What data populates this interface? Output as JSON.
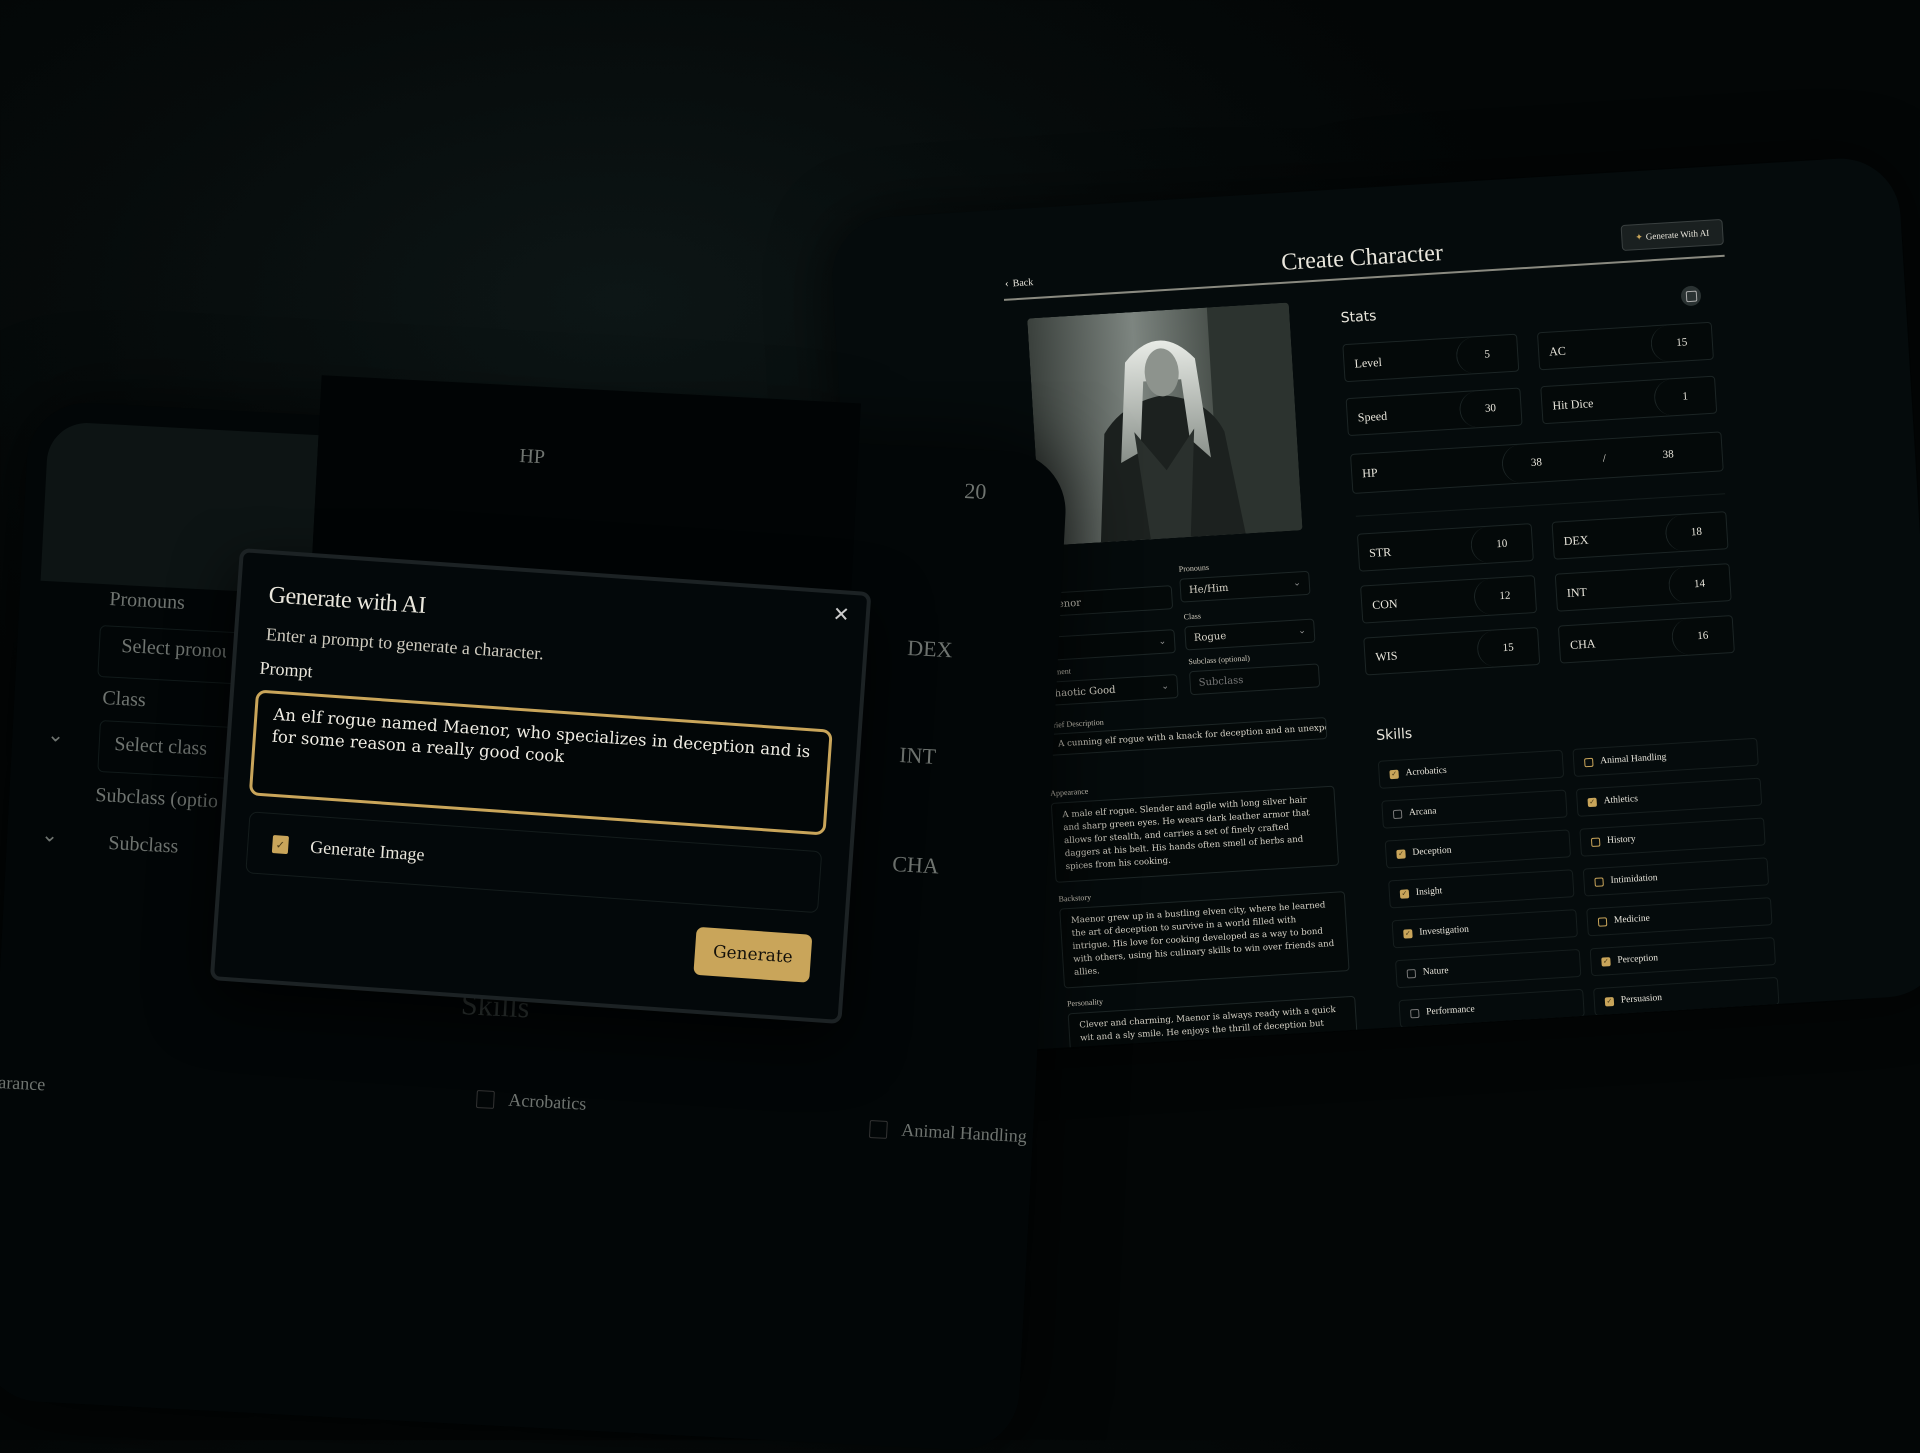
{
  "colors": {
    "accent": "#c9a55a",
    "background": "#030606",
    "panel": "#050b0c"
  },
  "character_form": {
    "back_label": "Back",
    "title": "Create Character",
    "generate_ai_label": "Generate With AI",
    "icons": {
      "back": "chevron-left-icon",
      "sparkle": "sparkle-icon",
      "dice": "dice-icon"
    },
    "name_value": "Maenor",
    "pronouns": {
      "label": "Pronouns",
      "value": "He/Him"
    },
    "class": {
      "label": "Class",
      "value": "Rogue"
    },
    "subclass": {
      "label": "Subclass (optional)",
      "placeholder": "Subclass"
    },
    "alignment": {
      "label": "Alignment",
      "value": "Chaotic Good"
    },
    "brief_description": {
      "label": "Brief Description",
      "value": "A cunning elf rogue with a knack for deception and an unexpe"
    },
    "appearance": {
      "label": "Appearance",
      "value": "A male elf rogue. Slender and agile with long silver hair and sharp green eyes. He wears dark leather armor that allows for stealth, and carries a set of finely crafted daggers at his belt. His hands often smell of herbs and spices from his cooking."
    },
    "backstory": {
      "label": "Backstory",
      "value": "Maenor grew up in a bustling elven city, where he learned the art of deception to survive in a world filled with intrigue. His love for cooking developed as a way to bond with others, using his culinary skills to win over friends and allies."
    },
    "personality": {
      "label": "Personality",
      "value": "Clever and charming, Maenor is always ready with a quick wit and a sly smile. He enjoys the thrill of deception but values loyalty and friendship above all."
    },
    "stats": {
      "title": "Stats",
      "level": {
        "label": "Level",
        "value": "5"
      },
      "ac": {
        "label": "AC",
        "value": "15"
      },
      "speed": {
        "label": "Speed",
        "value": "30"
      },
      "hit_dice": {
        "label": "Hit Dice",
        "value": "1"
      },
      "hp": {
        "label": "HP",
        "current": "38",
        "separator": "/",
        "max": "38"
      },
      "str": {
        "label": "STR",
        "value": "10"
      },
      "dex": {
        "label": "DEX",
        "value": "18"
      },
      "con": {
        "label": "CON",
        "value": "12"
      },
      "int": {
        "label": "INT",
        "value": "14"
      },
      "wis": {
        "label": "WIS",
        "value": "15"
      },
      "cha": {
        "label": "CHA",
        "value": "16"
      }
    },
    "skills": {
      "title": "Skills",
      "items": [
        {
          "label": "Acrobatics",
          "checked": true
        },
        {
          "label": "Animal Handling",
          "checked": false
        },
        {
          "label": "Arcana",
          "checked": false
        },
        {
          "label": "Athletics",
          "checked": true
        },
        {
          "label": "Deception",
          "checked": true
        },
        {
          "label": "History",
          "checked": false
        },
        {
          "label": "Insight",
          "checked": true
        },
        {
          "label": "Intimidation",
          "checked": false
        },
        {
          "label": "Investigation",
          "checked": true
        },
        {
          "label": "Medicine",
          "checked": false
        },
        {
          "label": "Nature",
          "checked": false
        },
        {
          "label": "Perception",
          "checked": true
        },
        {
          "label": "Performance",
          "checked": false
        },
        {
          "label": "Persuasion",
          "checked": true
        }
      ]
    }
  },
  "background_form": {
    "pronouns_label": "Pronouns",
    "pronouns_placeholder": "Select pronouns",
    "class_label": "Class",
    "class_placeholder": "Select class",
    "subclass_label": "Subclass (optional)",
    "subclass_placeholder": "Subclass",
    "hp_label": "HP",
    "hp_value": "20",
    "dex_label": "DEX",
    "int_label": "INT",
    "cha_label": "CHA",
    "skills_title": "Skills",
    "appearance_label": "Appearance",
    "skill_1": "Acrobatics",
    "skill_2": "Animal Handling"
  },
  "modal": {
    "title": "Generate with AI",
    "subtitle": "Enter a prompt to generate a character.",
    "prompt_label": "Prompt",
    "prompt_value": "An elf rogue named Maenor, who specializes in deception and is for some reason a really good cook",
    "generate_image_label": "Generate Image",
    "generate_image_checked": true,
    "generate_button": "Generate",
    "close_icon": "close-icon"
  }
}
